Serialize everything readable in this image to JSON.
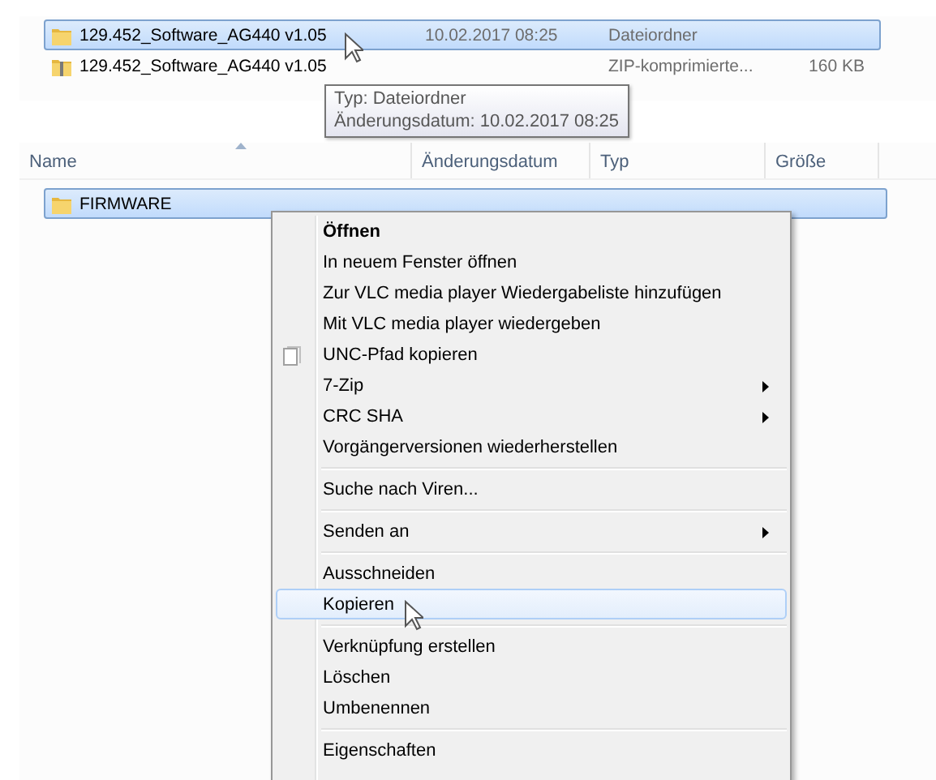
{
  "top_list": {
    "rows": [
      {
        "name": "129.452_Software_AG440 v1.05",
        "kind": "folder",
        "date": "10.02.2017 08:25",
        "type": "Dateiordner",
        "selected": true
      },
      {
        "name": "129.452_Software_AG440 v1.05",
        "kind": "zip",
        "type": "ZIP-komprimierte...",
        "size": "160 KB",
        "selected": false
      }
    ],
    "tooltip": {
      "lines": [
        "Typ: Dateiordner",
        "Änderungsdatum: 10.02.2017 08:25"
      ]
    }
  },
  "bottom_list": {
    "columns": [
      {
        "label": "Name",
        "sorted": true
      },
      {
        "label": "Änderungsdatum",
        "sorted": false
      },
      {
        "label": "Typ",
        "sorted": false
      },
      {
        "label": "Größe",
        "sorted": false
      }
    ],
    "rows": [
      {
        "name": "FIRMWARE",
        "kind": "folder",
        "selected": true
      }
    ]
  },
  "context_menu": {
    "items": [
      {
        "kind": "item",
        "label": "Öffnen",
        "default": true,
        "submenu": false,
        "icon": false,
        "selected": false
      },
      {
        "kind": "item",
        "label": "In neuem Fenster öffnen",
        "default": false,
        "submenu": false,
        "icon": false,
        "selected": false
      },
      {
        "kind": "item",
        "label": "Zur VLC media player Wiedergabeliste hinzufügen",
        "default": false,
        "submenu": false,
        "icon": false,
        "selected": false
      },
      {
        "kind": "item",
        "label": "Mit VLC media player wiedergeben",
        "default": false,
        "submenu": false,
        "icon": false,
        "selected": false
      },
      {
        "kind": "item",
        "label": "UNC-Pfad kopieren",
        "default": false,
        "submenu": false,
        "icon": true,
        "selected": false
      },
      {
        "kind": "item",
        "label": "7-Zip",
        "default": false,
        "submenu": true,
        "icon": false,
        "selected": false
      },
      {
        "kind": "item",
        "label": "CRC SHA",
        "default": false,
        "submenu": true,
        "icon": false,
        "selected": false
      },
      {
        "kind": "item",
        "label": "Vorgängerversionen wiederherstellen",
        "default": false,
        "submenu": false,
        "icon": false,
        "selected": false
      },
      {
        "kind": "separator"
      },
      {
        "kind": "item",
        "label": "Suche nach Viren...",
        "default": false,
        "submenu": false,
        "icon": false,
        "selected": false
      },
      {
        "kind": "separator"
      },
      {
        "kind": "item",
        "label": "Senden an",
        "default": false,
        "submenu": true,
        "icon": false,
        "selected": false
      },
      {
        "kind": "separator"
      },
      {
        "kind": "item",
        "label": "Ausschneiden",
        "default": false,
        "submenu": false,
        "icon": false,
        "selected": false
      },
      {
        "kind": "item",
        "label": "Kopieren",
        "default": false,
        "submenu": false,
        "icon": false,
        "selected": true
      },
      {
        "kind": "separator"
      },
      {
        "kind": "item",
        "label": "Verknüpfung erstellen",
        "default": false,
        "submenu": false,
        "icon": false,
        "selected": false
      },
      {
        "kind": "item",
        "label": "Löschen",
        "default": false,
        "submenu": false,
        "icon": false,
        "selected": false
      },
      {
        "kind": "item",
        "label": "Umbenennen",
        "default": false,
        "submenu": false,
        "icon": false,
        "selected": false
      },
      {
        "kind": "separator"
      },
      {
        "kind": "item",
        "label": "Eigenschaften",
        "default": false,
        "submenu": false,
        "icon": false,
        "selected": false
      }
    ]
  }
}
